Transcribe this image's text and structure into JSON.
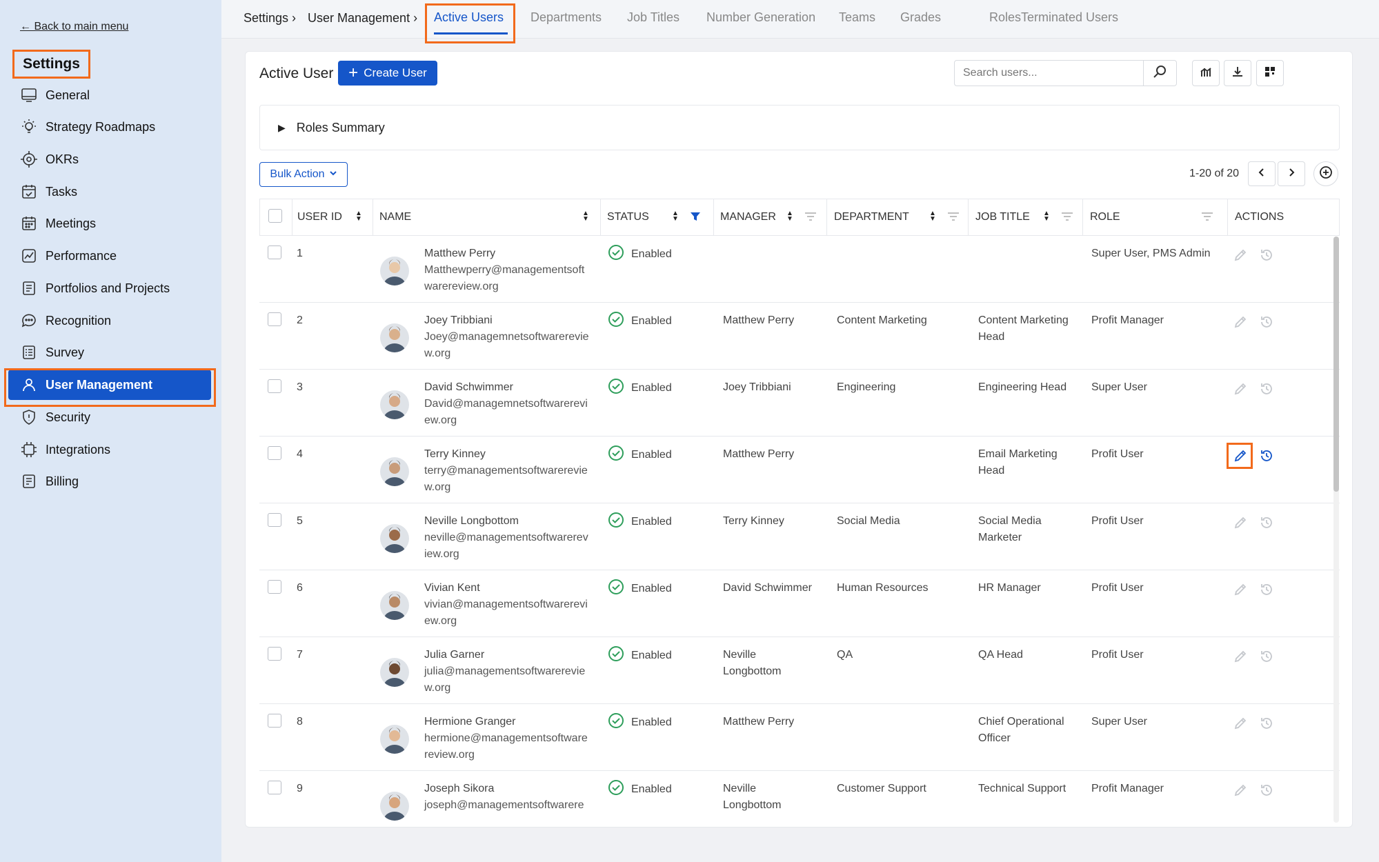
{
  "sidebar": {
    "back_link": "← Back to main menu",
    "title": "Settings",
    "items": [
      {
        "label": "General",
        "icon": "monitor-icon"
      },
      {
        "label": "Strategy Roadmaps",
        "icon": "lightbulb-icon"
      },
      {
        "label": "OKRs",
        "icon": "target-icon"
      },
      {
        "label": "Tasks",
        "icon": "calendar-check-icon"
      },
      {
        "label": "Meetings",
        "icon": "calendar-grid-icon"
      },
      {
        "label": "Performance",
        "icon": "chart-line-icon"
      },
      {
        "label": "Portfolios and Projects",
        "icon": "document-icon"
      },
      {
        "label": "Recognition",
        "icon": "chat-bubble-icon"
      },
      {
        "label": "Survey",
        "icon": "checklist-icon"
      },
      {
        "label": "User Management",
        "icon": "user-icon",
        "active": true
      },
      {
        "label": "Security",
        "icon": "shield-icon"
      },
      {
        "label": "Integrations",
        "icon": "chip-icon"
      },
      {
        "label": "Billing",
        "icon": "invoice-icon"
      }
    ]
  },
  "topbar": {
    "breadcrumb": [
      "Settings ›",
      "User Management ›"
    ],
    "tabs": [
      "Active Users",
      "Departments",
      "Job Titles",
      "Number Generation",
      "Teams",
      "Grades",
      "Roles",
      "Terminated Users"
    ],
    "active_tab": "Active Users"
  },
  "card": {
    "title": "Active User",
    "create_label": "Create User",
    "search_placeholder": "Search users...",
    "roles_summary": "Roles Summary",
    "bulk_action": "Bulk Action",
    "pager": "1-20 of 20"
  },
  "table": {
    "columns": [
      "USER ID",
      "NAME",
      "STATUS",
      "MANAGER",
      "DEPARTMENT",
      "JOB TITLE",
      "ROLE",
      "ACTIONS"
    ],
    "rows": [
      {
        "id": "1",
        "name": "Matthew Perry",
        "email1": "Matthewperry@managementsoft",
        "email2": "warereview.org",
        "email3": "",
        "status": "Enabled",
        "manager1": "",
        "manager2": "",
        "department": "",
        "job1": "",
        "job2": "",
        "role": "Super User, PMS Admin"
      },
      {
        "id": "2",
        "name": "Joey Tribbiani",
        "email1": "Joey@managemnetsoftwarerevie",
        "email2": "w.org",
        "email3": "",
        "status": "Enabled",
        "manager1": "Matthew Perry",
        "manager2": "",
        "department": "Content Marketing",
        "job1": "Content Marketing",
        "job2": "Head",
        "role": "Profit Manager"
      },
      {
        "id": "3",
        "name": "David Schwimmer",
        "email1": "David@managemnetsoftwarerevi",
        "email2": "ew.org",
        "email3": "",
        "status": "Enabled",
        "manager1": "Joey Tribbiani",
        "manager2": "",
        "department": "Engineering",
        "job1": "Engineering Head",
        "job2": "",
        "role": "Super User"
      },
      {
        "id": "4",
        "name": "Terry Kinney",
        "email1": "terry@managementsoftwarerevie",
        "email2": "w.org",
        "email3": "",
        "status": "Enabled",
        "manager1": "Matthew Perry",
        "manager2": "",
        "department": "",
        "job1": "Email Marketing",
        "job2": "Head",
        "role": "Profit User"
      },
      {
        "id": "5",
        "name": "Neville Longbottom",
        "email1": "neville@managementsoftwarerev",
        "email2": "iew.org",
        "email3": "",
        "status": "Enabled",
        "manager1": "Terry Kinney",
        "manager2": "",
        "department": "Social Media",
        "job1": "Social Media",
        "job2": "Marketer",
        "role": "Profit User"
      },
      {
        "id": "6",
        "name": "Vivian Kent",
        "email1": "vivian@managementsoftwarerevi",
        "email2": "ew.org",
        "email3": "",
        "status": "Enabled",
        "manager1": "David Schwimmer",
        "manager2": "",
        "department": "Human Resources",
        "job1": "HR Manager",
        "job2": "",
        "role": "Profit User"
      },
      {
        "id": "7",
        "name": "Julia Garner",
        "email1": "julia@managementsoftwarerevie",
        "email2": "w.org",
        "email3": "",
        "status": "Enabled",
        "manager1": "Neville",
        "manager2": "Longbottom",
        "department": "QA",
        "job1": "QA Head",
        "job2": "",
        "role": "Profit User"
      },
      {
        "id": "8",
        "name": "Hermione Granger",
        "email1": "hermione@managementsoftware",
        "email2": "review.org",
        "email3": "",
        "status": "Enabled",
        "manager1": "Matthew Perry",
        "manager2": "",
        "department": "",
        "job1": "Chief Operational",
        "job2": "Officer",
        "role": "Super User"
      },
      {
        "id": "9",
        "name": "Joseph Sikora",
        "email1": "joseph@managementsoftwarere",
        "email2": "",
        "email3": "",
        "status": "Enabled",
        "manager1": "Neville",
        "manager2": "Longbottom",
        "department": "Customer Support",
        "job1": "Technical Support",
        "job2": "",
        "role": "Profit Manager"
      }
    ]
  },
  "colors": {
    "accent": "#1556c9",
    "highlight": "#f26a1b",
    "enabled": "#2e9e5b",
    "sidebar_bg": "#dce7f5"
  }
}
